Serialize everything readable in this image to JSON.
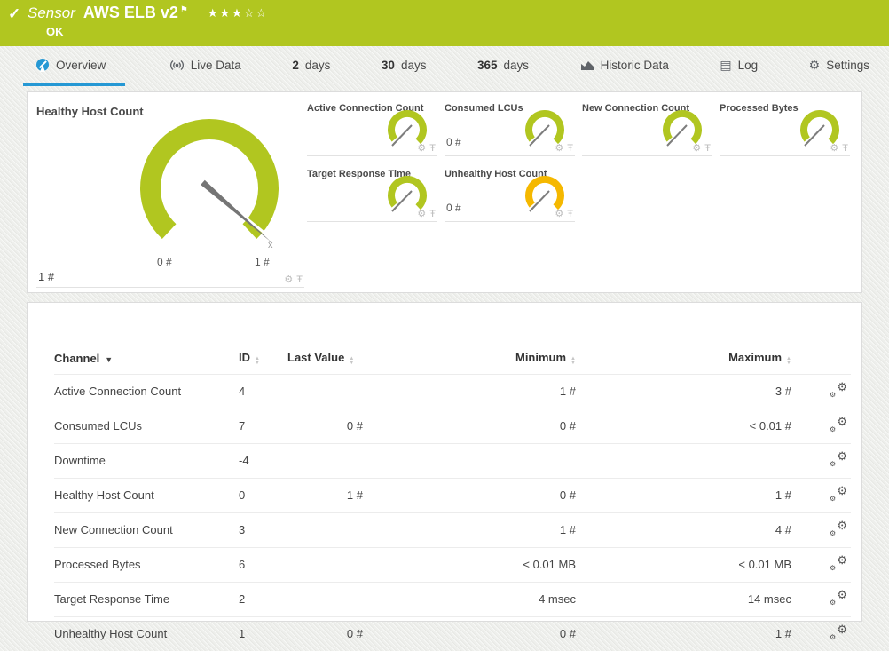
{
  "icons": {
    "check": "✓",
    "flag": "⚑",
    "stars": "★★★☆☆",
    "gear": "⚙",
    "pin": "Ŧ",
    "sort_up": "▲",
    "sort_down": "▼",
    "sort_active": "▼",
    "log": "▤",
    "avg_marker": "x̄"
  },
  "header": {
    "kind": "Sensor",
    "name": "AWS ELB v2",
    "status": "OK",
    "color": "#b1c620"
  },
  "tabs": {
    "overview": "Overview",
    "live": "Live Data",
    "d2_num": "2",
    "d2_label": "days",
    "d30_num": "30",
    "d30_label": "days",
    "d365_num": "365",
    "d365_label": "days",
    "historic": "Historic Data",
    "log": "Log",
    "settings": "Settings",
    "active_color": "#2598d4"
  },
  "gauges": {
    "main": {
      "title": "Healthy Host Count",
      "value": "1 #",
      "scale_min": "0 #",
      "scale_max": "1 #",
      "color": "#b1c620"
    },
    "small": [
      {
        "title": "Active Connection Count",
        "value": "",
        "color": "#b1c620"
      },
      {
        "title": "Consumed LCUs",
        "value": "0 #",
        "color": "#b1c620"
      },
      {
        "title": "New Connection Count",
        "value": "",
        "color": "#b1c620"
      },
      {
        "title": "Processed Bytes",
        "value": "",
        "color": "#b1c620"
      },
      {
        "title": "Target Response Time",
        "value": "",
        "color": "#b1c620"
      },
      {
        "title": "Unhealthy Host Count",
        "value": "0 #",
        "color": "#f5b800"
      }
    ]
  },
  "table": {
    "headers": {
      "channel": "Channel",
      "id": "ID",
      "last": "Last Value",
      "min": "Minimum",
      "max": "Maximum"
    },
    "rows": [
      {
        "channel": "Active Connection Count",
        "id": "4",
        "last": "",
        "min": "1 #",
        "max": "3 #"
      },
      {
        "channel": "Consumed LCUs",
        "id": "7",
        "last": "0 #",
        "min": "0 #",
        "max": "< 0.01 #"
      },
      {
        "channel": "Downtime",
        "id": "-4",
        "last": "",
        "min": "",
        "max": ""
      },
      {
        "channel": "Healthy Host Count",
        "id": "0",
        "last": "1 #",
        "min": "0 #",
        "max": "1 #"
      },
      {
        "channel": "New Connection Count",
        "id": "3",
        "last": "",
        "min": "1 #",
        "max": "4 #"
      },
      {
        "channel": "Processed Bytes",
        "id": "6",
        "last": "",
        "min": "< 0.01 MB",
        "max": "< 0.01 MB"
      },
      {
        "channel": "Target Response Time",
        "id": "2",
        "last": "",
        "min": "4 msec",
        "max": "14 msec"
      },
      {
        "channel": "Unhealthy Host Count",
        "id": "1",
        "last": "0 #",
        "min": "0 #",
        "max": "1 #"
      }
    ]
  }
}
